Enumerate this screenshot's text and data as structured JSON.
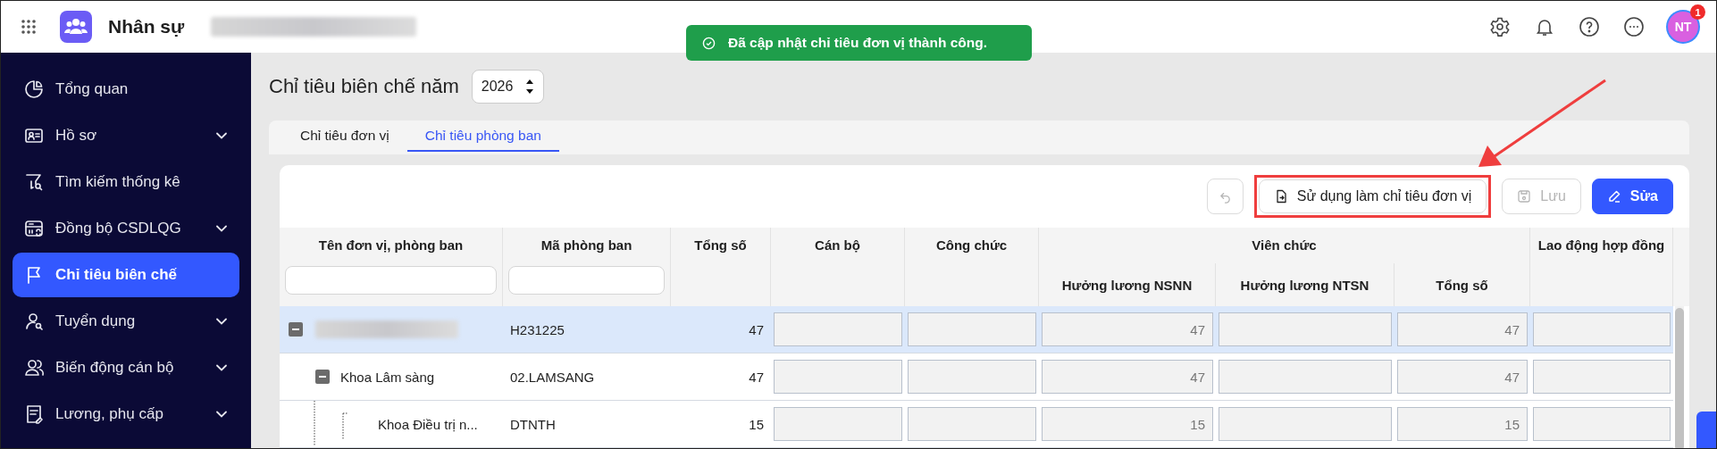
{
  "app": {
    "title": "Nhân sự",
    "org_redacted": true
  },
  "topbar": {
    "avatar": {
      "initials": "NT",
      "badge": "1"
    }
  },
  "toast": {
    "message": "Đã cập nhật chỉ tiêu đơn vị thành công."
  },
  "sidebar": {
    "items": [
      {
        "label": "Tổng quan",
        "has_submenu": false,
        "selected": false
      },
      {
        "label": "Hồ sơ",
        "has_submenu": true,
        "selected": false
      },
      {
        "label": "Tìm kiếm thống kê",
        "has_submenu": false,
        "selected": false
      },
      {
        "label": "Đồng bộ CSDLQG",
        "has_submenu": true,
        "selected": false
      },
      {
        "label": "Chỉ tiêu biên chế",
        "has_submenu": false,
        "selected": true
      },
      {
        "label": "Tuyển dụng",
        "has_submenu": true,
        "selected": false
      },
      {
        "label": "Biến động cán bộ",
        "has_submenu": true,
        "selected": false
      },
      {
        "label": "Lương, phụ cấp",
        "has_submenu": true,
        "selected": false
      }
    ]
  },
  "page": {
    "title": "Chỉ tiêu biên chế năm",
    "year": "2026"
  },
  "tabs": [
    {
      "label": "Chỉ tiêu đơn vị",
      "selected": false
    },
    {
      "label": "Chỉ tiêu phòng ban",
      "selected": true
    }
  ],
  "toolbar": {
    "buttons": [
      {
        "kind": "undo",
        "disabled": true
      },
      {
        "kind": "import",
        "label": "Sử dụng làm chỉ tiêu đơn vị",
        "disabled": false,
        "highlighted": true
      },
      {
        "kind": "save",
        "label": "Lưu",
        "disabled": true
      },
      {
        "kind": "edit",
        "label": "Sửa",
        "disabled": false
      }
    ]
  },
  "table": {
    "columns": [
      {
        "label": "Tên đơn vị, phòng ban",
        "filter": true
      },
      {
        "label": "Mã phòng ban",
        "filter": true
      },
      {
        "label": "Tổng số"
      },
      {
        "label": "Cán bộ"
      },
      {
        "label": "Công chức"
      },
      {
        "label": "Viên chức",
        "children": [
          {
            "label": "Hưởng lương NSNN"
          },
          {
            "label": "Hưởng lương NTSN"
          },
          {
            "label": "Tổng số"
          }
        ]
      },
      {
        "label": "Lao động hợp đồng"
      }
    ],
    "rows": [
      {
        "kind": "redacted",
        "code": "H231225",
        "total": "47",
        "values": [
          {
            "kind": "blank"
          },
          {
            "kind": "blank"
          },
          {
            "kind": "value",
            "text": "47"
          },
          {
            "kind": "blank"
          },
          {
            "kind": "value",
            "text": "47"
          },
          {
            "kind": "blank"
          }
        ],
        "expanded": true,
        "selected": true,
        "children": [
          {
            "kind": "named",
            "name": "Khoa Lâm sàng",
            "code": "02.LAMSANG",
            "total": "47",
            "values": [
              {
                "kind": "blank"
              },
              {
                "kind": "blank"
              },
              {
                "kind": "value",
                "text": "47"
              },
              {
                "kind": "blank"
              },
              {
                "kind": "value",
                "text": "47"
              },
              {
                "kind": "blank"
              }
            ],
            "expanded": true,
            "selected": false,
            "children": [
              {
                "kind": "named",
                "name": "Khoa Điều trị n...",
                "code": "DTNTH",
                "total": "15",
                "values": [
                  {
                    "kind": "blank"
                  },
                  {
                    "kind": "blank"
                  },
                  {
                    "kind": "value",
                    "text": "15"
                  },
                  {
                    "kind": "blank"
                  },
                  {
                    "kind": "value",
                    "text": "15"
                  },
                  {
                    "kind": "blank"
                  }
                ],
                "selected": false
              }
            ]
          }
        ]
      }
    ]
  }
}
